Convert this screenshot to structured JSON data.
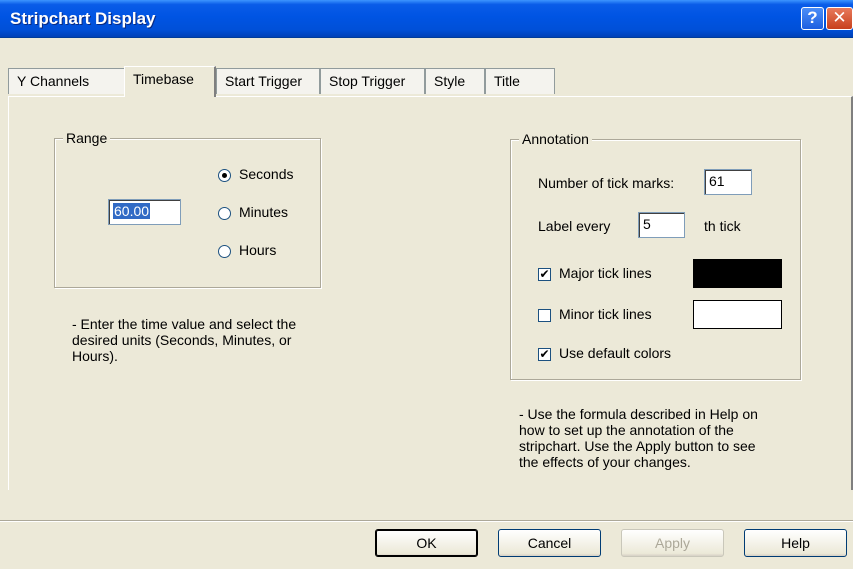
{
  "window": {
    "title": "Stripchart Display",
    "help_glyph": "?",
    "close_glyph": "✕"
  },
  "tabs": [
    {
      "label": "Y Channels",
      "active": false
    },
    {
      "label": "Timebase",
      "active": true
    },
    {
      "label": "Start Trigger",
      "active": false
    },
    {
      "label": "Stop Trigger",
      "active": false
    },
    {
      "label": "Style",
      "active": false
    },
    {
      "label": "Title",
      "active": false
    }
  ],
  "range": {
    "title": "Range",
    "value": "60.00",
    "units": [
      {
        "label": "Seconds",
        "selected": true
      },
      {
        "label": "Minutes",
        "selected": false
      },
      {
        "label": "Hours",
        "selected": false
      }
    ],
    "help_lines": [
      "- Enter the time value and select the",
      "desired units (Seconds, Minutes, or",
      "Hours)."
    ]
  },
  "annotation": {
    "title": "Annotation",
    "tick_marks_label": "Number of tick marks:",
    "tick_marks_value": "61",
    "label_every_label": "Label every",
    "label_every_value": "5",
    "label_every_suffix": "th tick",
    "major_tick_label": "Major tick lines",
    "major_tick_checked": true,
    "major_tick_color": "#000000",
    "minor_tick_label": "Minor tick lines",
    "minor_tick_checked": false,
    "minor_tick_color": "#ffffff",
    "default_colors_label": "Use default colors",
    "default_colors_checked": true,
    "help_lines": [
      "- Use the formula described in Help on",
      "how to set up the annotation of the",
      "stripchart.  Use the Apply button to see",
      "the effects of your changes."
    ]
  },
  "buttons": {
    "ok": "OK",
    "cancel": "Cancel",
    "apply": "Apply",
    "help": "Help"
  },
  "check_glyph": "✔"
}
